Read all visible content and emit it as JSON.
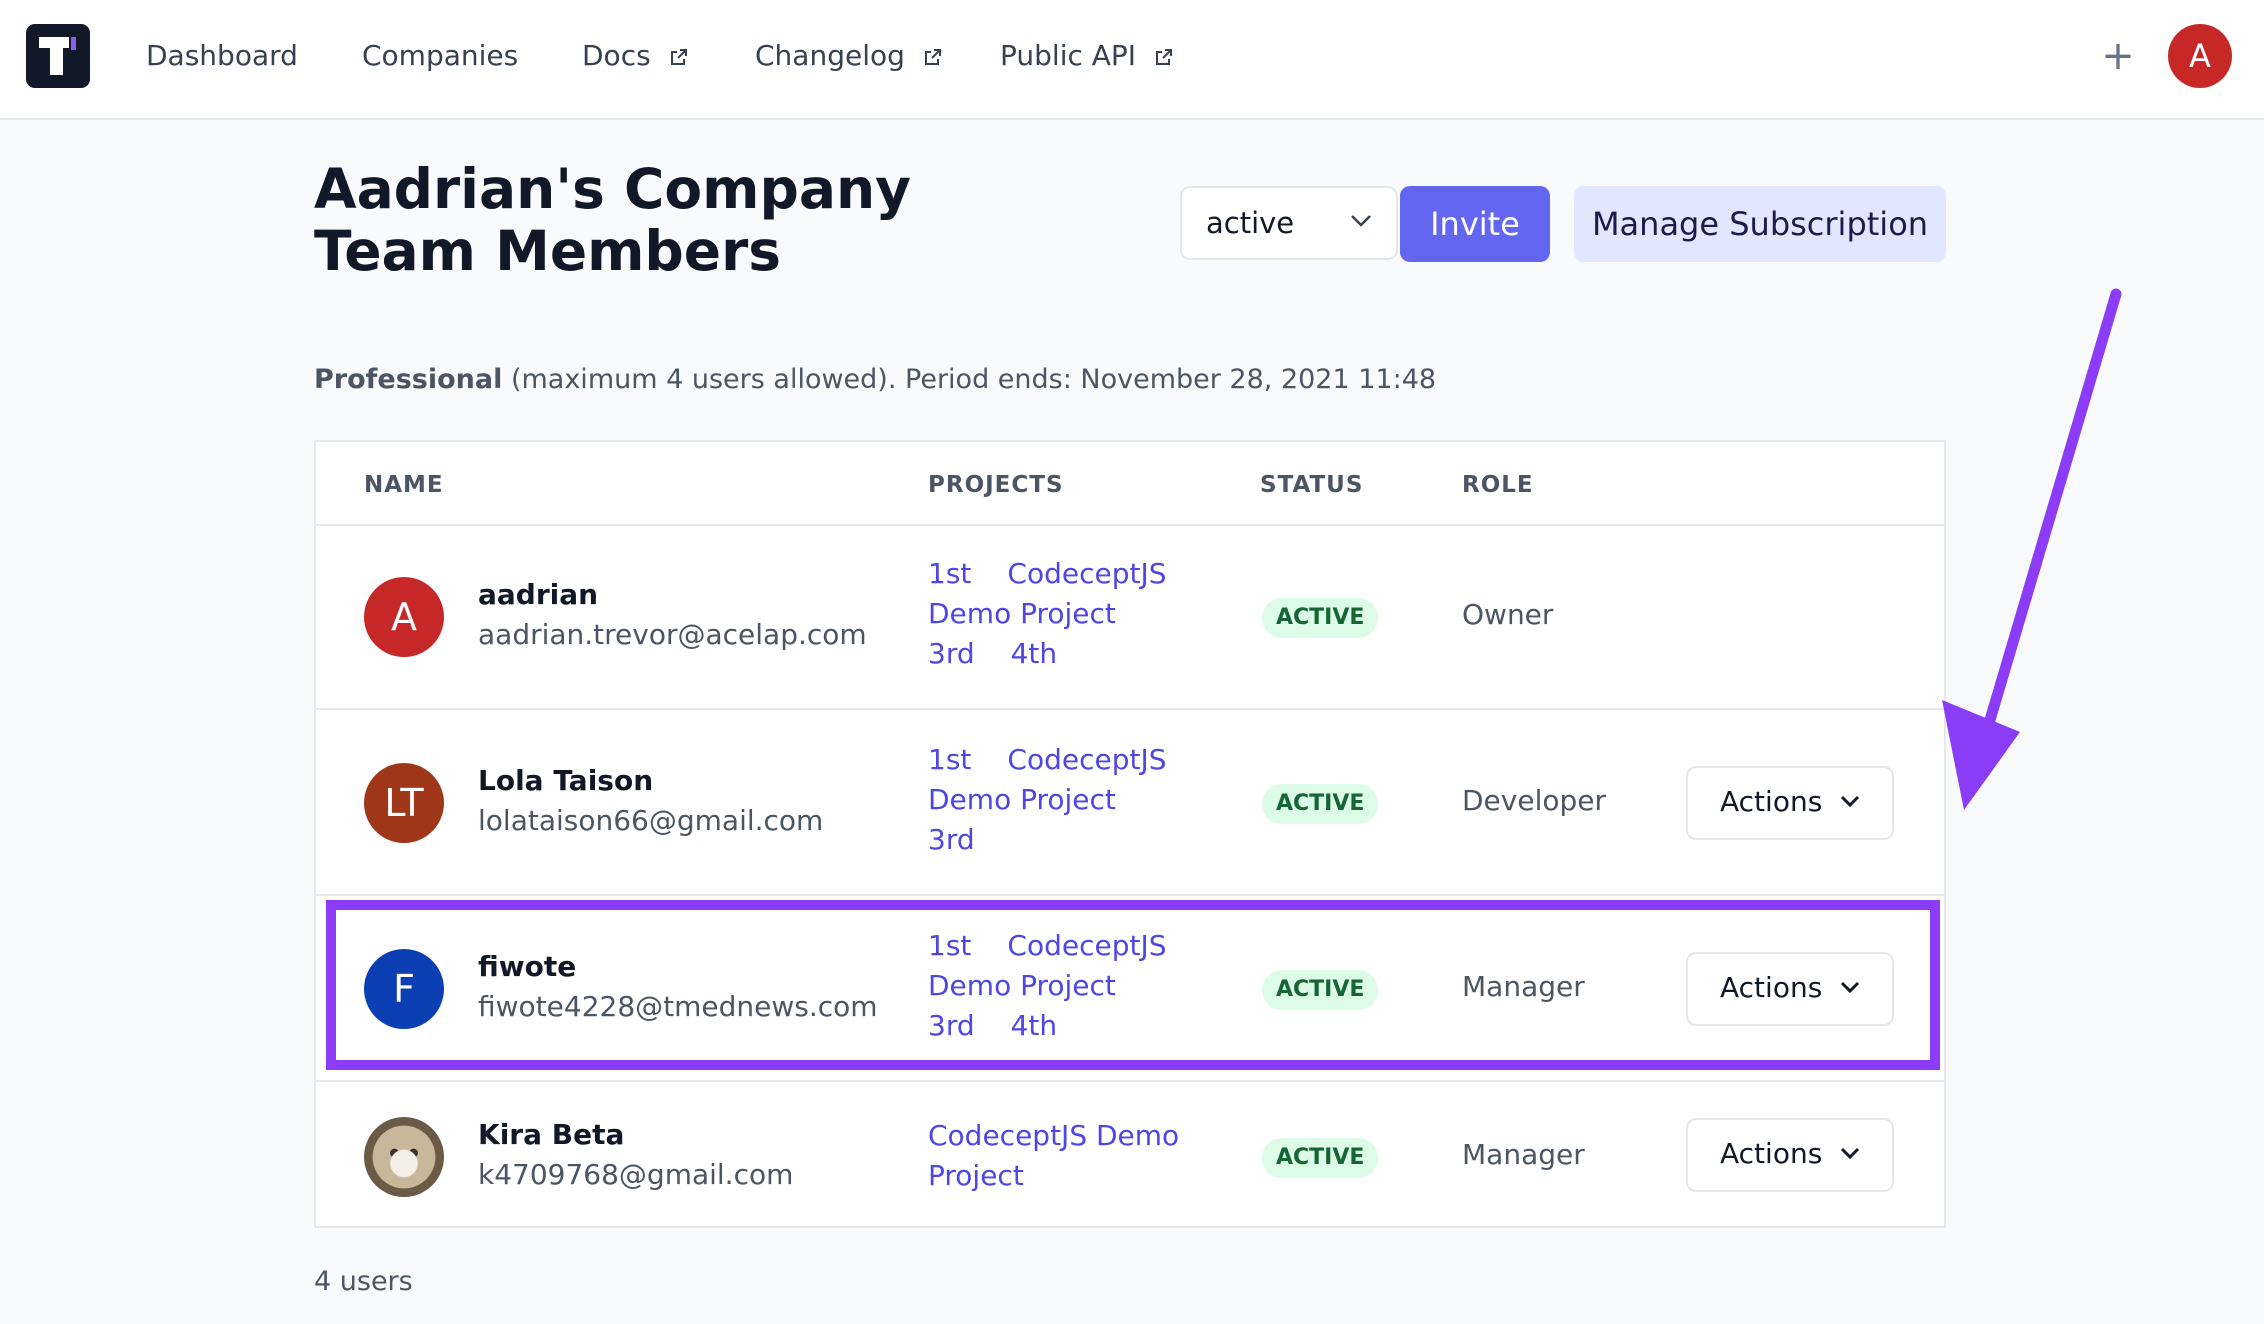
{
  "nav": {
    "links": [
      "Dashboard",
      "Companies",
      "Docs",
      "Changelog",
      "Public API"
    ],
    "plus_symbol": "+",
    "user_initial": "A"
  },
  "header": {
    "title": "Aadrian's Company Team Members",
    "status_filter": "active",
    "invite_label": "Invite",
    "manage_label": "Manage Subscription"
  },
  "plan": {
    "name": "Professional",
    "details": "(maximum 4 users allowed). Period ends: November 28, 2021 11:48"
  },
  "table": {
    "columns": [
      "NAME",
      "PROJECTS",
      "STATUS",
      "ROLE"
    ],
    "rows": [
      {
        "initials": "A",
        "avatar_color": "#c62828",
        "name": "aadrian",
        "email": "aadrian.trevor@acelap.com",
        "projects": [
          "1st",
          "CodeceptJS",
          "Demo Project",
          "3rd",
          "4th"
        ],
        "status": "ACTIVE",
        "role": "Owner"
      },
      {
        "initials": "LT",
        "avatar_color": "#a0361a",
        "name": "Lola Taison",
        "email": "lolataison66@gmail.com",
        "projects": [
          "1st",
          "CodeceptJS",
          "Demo Project",
          "3rd"
        ],
        "status": "ACTIVE",
        "role": "Developer",
        "actions_label": "Actions"
      },
      {
        "initials": "F",
        "avatar_color": "#0b3fb3",
        "name": "fiwote",
        "email": "fiwote4228@tmednews.com",
        "projects": [
          "1st",
          "CodeceptJS",
          "Demo Project",
          "3rd",
          "4th"
        ],
        "status": "ACTIVE",
        "role": "Manager",
        "actions_label": "Actions"
      },
      {
        "initials": "",
        "avatar_image": "cat-photo",
        "name": "Kira Beta",
        "email": "k4709768@gmail.com",
        "projects": [
          "CodeceptJS Demo Project"
        ],
        "status": "ACTIVE",
        "role": "Manager",
        "actions_label": "Actions"
      }
    ]
  },
  "footer": {
    "count": "4 users"
  },
  "colors": {
    "accent": "#6366f1",
    "highlight": "#8b3cf6",
    "active_badge_bg": "#dcfce7",
    "active_badge_text": "#166534"
  },
  "icons": [
    "external-link-icon",
    "chevron-down-icon",
    "plus-icon"
  ]
}
